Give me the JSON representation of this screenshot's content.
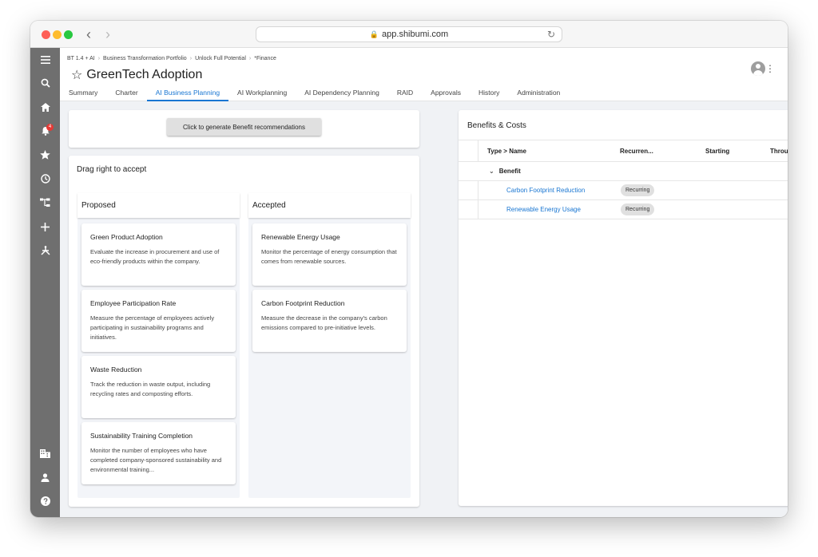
{
  "browser": {
    "url": "app.shibumi.com",
    "lock_icon": "lock-icon",
    "reload_icon": "reload-icon"
  },
  "rail": {
    "icons": [
      "menu-icon",
      "search-icon",
      "home-icon",
      "notifications-icon",
      "star-icon",
      "history-icon",
      "hierarchy-icon",
      "add-icon",
      "apps-icon",
      "building-icon",
      "person-icon",
      "help-icon",
      "shibumi-logo-icon"
    ],
    "notification_count": "4"
  },
  "header": {
    "breadcrumb": [
      "BT 1.4 + AI",
      "Business Transformation Portfolio",
      "Unlock Full Potential",
      "*Finance"
    ],
    "breadcrumb_sep": "›",
    "star": "☆",
    "title": "GreenTech Adoption",
    "more": "⋮"
  },
  "tabs": [
    {
      "label": "Summary",
      "active": false
    },
    {
      "label": "Charter",
      "active": false
    },
    {
      "label": "AI Business Planning",
      "active": true
    },
    {
      "label": "AI Workplanning",
      "active": false
    },
    {
      "label": "AI Dependency Planning",
      "active": false
    },
    {
      "label": "RAID",
      "active": false
    },
    {
      "label": "Approvals",
      "active": false
    },
    {
      "label": "History",
      "active": false
    },
    {
      "label": "Administration",
      "active": false
    }
  ],
  "generate": {
    "button_label": "Click to generate Benefit recommendations"
  },
  "board": {
    "title": "Drag right to accept",
    "proposed": {
      "label": "Proposed",
      "cards": [
        {
          "title": "Green Product Adoption",
          "desc": "Evaluate the increase in procurement and use of eco-friendly products within the company."
        },
        {
          "title": "Employee Participation Rate",
          "desc": "Measure the percentage of employees actively participating in sustainability programs and initiatives."
        },
        {
          "title": "Waste Reduction",
          "desc": "Track the reduction in waste output, including recycling rates and composting efforts."
        },
        {
          "title": "Sustainability Training Completion",
          "desc": "Monitor the number of employees who have completed company-sponsored sustainability and environmental training..."
        }
      ]
    },
    "accepted": {
      "label": "Accepted",
      "cards": [
        {
          "title": "Renewable Energy Usage",
          "desc": "Monitor the percentage of energy consumption that comes from renewable sources."
        },
        {
          "title": "Carbon Footprint Reduction",
          "desc": "Measure the decrease in the company's carbon emissions compared to pre-initiative levels."
        }
      ]
    }
  },
  "benefits": {
    "title": "Benefits & Costs",
    "add": "+",
    "columns": [
      "Type > Name",
      "Recurren...",
      "Starting",
      "Through"
    ],
    "group": {
      "chevron": "⌄",
      "label": "Benefit"
    },
    "rows": [
      {
        "name": "Carbon Footprint Reduction",
        "recurrence": "Recurring"
      },
      {
        "name": "Renewable Energy Usage",
        "recurrence": "Recurring"
      }
    ]
  }
}
